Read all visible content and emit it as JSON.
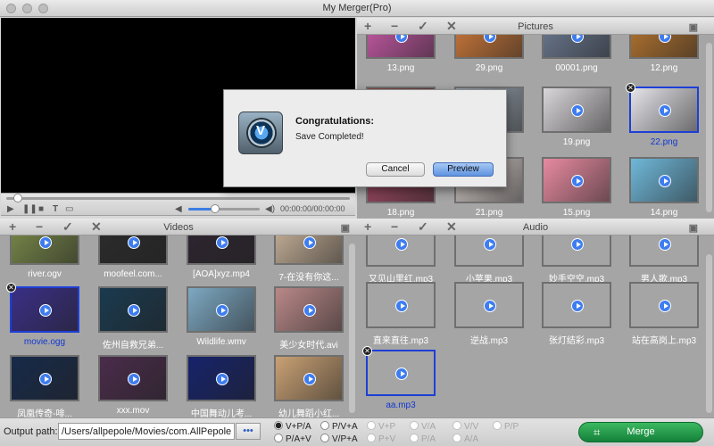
{
  "window": {
    "title": "My Merger(Pro)"
  },
  "player": {
    "timecode": "00:00:00/00:00:00",
    "seek_progress": 0.02,
    "volume_level": 0.38,
    "controls": [
      "play-icon",
      "pause-icon",
      "stop-icon",
      "text-icon",
      "subtitle-icon",
      "volume-low-icon",
      "volume-high-icon"
    ]
  },
  "panels": {
    "pictures": {
      "title": "Pictures",
      "toolbar": [
        "+",
        "−",
        "✓",
        "✕"
      ],
      "items": [
        {
          "caption": "13.png",
          "color": "#c85aa8",
          "selected": false
        },
        {
          "caption": "29.png",
          "color": "#d07a3a",
          "selected": false
        },
        {
          "caption": "00001.png",
          "color": "#6d7b93",
          "selected": false
        },
        {
          "caption": "12.png",
          "color": "#b7762f",
          "selected": false
        },
        {
          "caption": "",
          "color": "#8a4c4a",
          "selected": false
        },
        {
          "caption": "",
          "color": "#9aa4b0",
          "selected": false
        },
        {
          "caption": "19.png",
          "color": "#d9d6d9",
          "selected": false
        },
        {
          "caption": "22.png",
          "color": "#e4e4e9",
          "selected": true
        },
        {
          "caption": "18.png",
          "color": "#a54a66",
          "selected": false
        },
        {
          "caption": "21.png",
          "color": "#d2c9c6",
          "selected": false
        },
        {
          "caption": "15.png",
          "color": "#e78aa0",
          "selected": false
        },
        {
          "caption": "14.png",
          "color": "#6fb8d9",
          "selected": false
        }
      ]
    },
    "videos": {
      "title": "Videos",
      "toolbar": [
        "+",
        "−",
        "✓",
        "✕"
      ],
      "items": [
        {
          "caption": "river.ogv",
          "color": "#7a8a4a",
          "selected": false
        },
        {
          "caption": "moofeel.com...",
          "color": "#2b2b2b",
          "selected": false
        },
        {
          "caption": "[AOA]xyz.mp4",
          "color": "#2e2530",
          "selected": false
        },
        {
          "caption": "7-在没有你这...",
          "color": "#c8b39a",
          "selected": false
        },
        {
          "caption": "movie.ogg",
          "color": "#3a2f86",
          "selected": true
        },
        {
          "caption": "佐州自救兄弟...",
          "color": "#1a3a4f",
          "selected": false
        },
        {
          "caption": "Wildlife.wmv",
          "color": "#7da8c2",
          "selected": false
        },
        {
          "caption": "美少女时代.avi",
          "color": "#b98888",
          "selected": false
        },
        {
          "caption": "凤凰传奇-啡...",
          "color": "#172a4a",
          "selected": false
        },
        {
          "caption": "xxx.mov",
          "color": "#4a2c4a",
          "selected": false
        },
        {
          "caption": "中国舞动儿考...",
          "color": "#16236b",
          "selected": false
        },
        {
          "caption": "幼儿舞蹈小红...",
          "color": "#c9a174",
          "selected": false
        }
      ]
    },
    "audio": {
      "title": "Audio",
      "toolbar": [
        "+",
        "−",
        "✓",
        "✕"
      ],
      "items": [
        {
          "caption": "又见山里红.mp3",
          "selected": false
        },
        {
          "caption": "小苹果.mp3",
          "selected": false
        },
        {
          "caption": "妙手空空.mp3",
          "selected": false
        },
        {
          "caption": "男人歌.mp3",
          "selected": false
        },
        {
          "caption": "直来直往.mp3",
          "selected": false
        },
        {
          "caption": "逆战.mp3",
          "selected": false
        },
        {
          "caption": "张灯结彩.mp3",
          "selected": false
        },
        {
          "caption": "站在高岗上.mp3",
          "selected": false
        },
        {
          "caption": "aa.mp3",
          "selected": true
        }
      ]
    }
  },
  "output": {
    "label": "Output path:",
    "path": "/Users/allpepole/Movies/com.AllPepole",
    "browse_label": "•••"
  },
  "modes": [
    {
      "label": "V+P/A",
      "selected": true,
      "enabled": true
    },
    {
      "label": "P/V+A",
      "selected": false,
      "enabled": true
    },
    {
      "label": "V+P",
      "selected": false,
      "enabled": false
    },
    {
      "label": "V/A",
      "selected": false,
      "enabled": false
    },
    {
      "label": "V/V",
      "selected": false,
      "enabled": false
    },
    {
      "label": "P/P",
      "selected": false,
      "enabled": false
    },
    {
      "label": "P/A+V",
      "selected": false,
      "enabled": true
    },
    {
      "label": "V/P+A",
      "selected": false,
      "enabled": true
    },
    {
      "label": "P+V",
      "selected": false,
      "enabled": false
    },
    {
      "label": "P/A",
      "selected": false,
      "enabled": false
    },
    {
      "label": "A/A",
      "selected": false,
      "enabled": false
    }
  ],
  "merge": {
    "label": "Merge",
    "icon": "crop-icon"
  },
  "dialog": {
    "title": "Congratulations:",
    "message": "Save Completed!",
    "cancel_label": "Cancel",
    "preview_label": "Preview",
    "icon": "app-logo-icon"
  }
}
